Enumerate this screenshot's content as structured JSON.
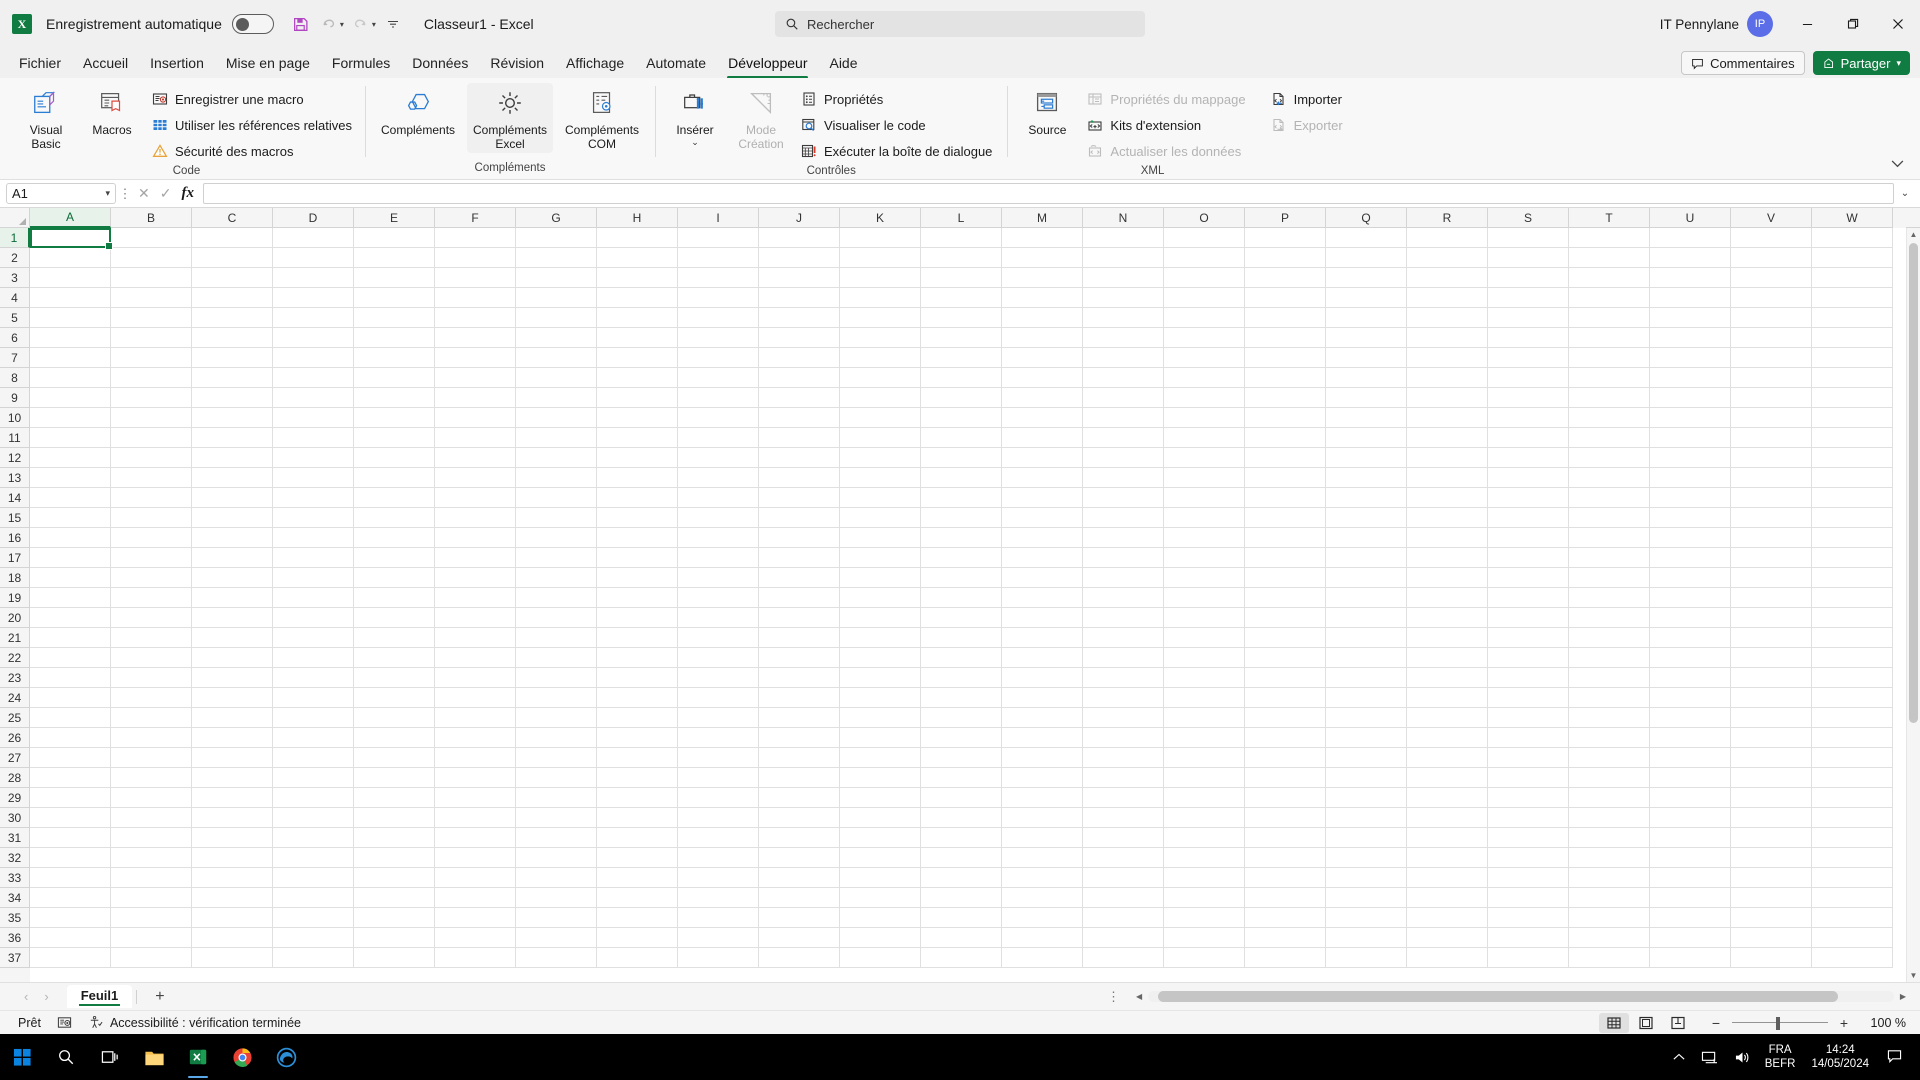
{
  "titlebar": {
    "app_logo": "excel-logo",
    "logo_letter": "X",
    "autosave_label": "Enregistrement automatique",
    "autosave_state": "off",
    "qat": [
      {
        "name": "save",
        "icon": "save-icon"
      },
      {
        "name": "undo",
        "icon": "undo-icon"
      },
      {
        "name": "redo",
        "icon": "redo-icon"
      },
      {
        "name": "customize-quick-access-toolbar",
        "icon": "chevron-down-icon"
      }
    ],
    "document_title": "Classeur1  -  Excel",
    "search_placeholder": "Rechercher",
    "user_name": "IT Pennylane",
    "user_initials": "IP",
    "window": {
      "minimize": "—",
      "restore": "❐",
      "close": "✕"
    }
  },
  "tabs": [
    {
      "label": "Fichier",
      "active": false
    },
    {
      "label": "Accueil",
      "active": false
    },
    {
      "label": "Insertion",
      "active": false
    },
    {
      "label": "Mise en page",
      "active": false
    },
    {
      "label": "Formules",
      "active": false
    },
    {
      "label": "Données",
      "active": false
    },
    {
      "label": "Révision",
      "active": false
    },
    {
      "label": "Affichage",
      "active": false
    },
    {
      "label": "Automate",
      "active": false
    },
    {
      "label": "Développeur",
      "active": true
    },
    {
      "label": "Aide",
      "active": false
    }
  ],
  "tabstrip_right": {
    "comments_label": "Commentaires",
    "share_label": "Partager"
  },
  "ribbon": {
    "groups": [
      {
        "title": "Code",
        "big_buttons": [
          {
            "label": "Visual Basic",
            "icon": "visual-basic-icon",
            "disabled": false,
            "highlighted": false
          },
          {
            "label": "Macros",
            "icon": "macros-icon",
            "disabled": false,
            "highlighted": false
          }
        ],
        "small_items": [
          {
            "label": "Enregistrer une macro",
            "icon": "record-macro-icon",
            "disabled": false
          },
          {
            "label": "Utiliser les références relatives",
            "icon": "relative-references-icon",
            "disabled": false
          },
          {
            "label": "Sécurité des macros",
            "icon": "macro-security-icon",
            "disabled": false
          }
        ]
      },
      {
        "title": "Compléments",
        "big_buttons": [
          {
            "label": "Compléments",
            "icon": "addins-icon",
            "disabled": false,
            "highlighted": false
          },
          {
            "label": "Compléments Excel",
            "icon": "excel-addins-icon",
            "disabled": false,
            "highlighted": true
          },
          {
            "label": "Compléments COM",
            "icon": "com-addins-icon",
            "disabled": false,
            "highlighted": false
          }
        ],
        "small_items": []
      },
      {
        "title": "Contrôles",
        "big_buttons": [
          {
            "label": "Insérer",
            "icon": "insert-control-icon",
            "disabled": false,
            "highlighted": false,
            "has_caret": true
          },
          {
            "label": "Mode Création",
            "icon": "design-mode-icon",
            "disabled": true,
            "highlighted": false
          }
        ],
        "small_items": [
          {
            "label": "Propriétés",
            "icon": "properties-icon",
            "disabled": false
          },
          {
            "label": "Visualiser le code",
            "icon": "view-code-icon",
            "disabled": false
          },
          {
            "label": "Exécuter la boîte de dialogue",
            "icon": "run-dialog-icon",
            "disabled": false
          }
        ]
      },
      {
        "title": "XML",
        "big_buttons": [
          {
            "label": "Source",
            "icon": "xml-source-icon",
            "disabled": false,
            "highlighted": false
          }
        ],
        "small_items": [
          {
            "label": "Propriétés du mappage",
            "icon": "map-properties-icon",
            "disabled": true
          },
          {
            "label": "Kits d'extension",
            "icon": "expansion-packs-icon",
            "disabled": false
          },
          {
            "label": "Actualiser les données",
            "icon": "refresh-data-icon",
            "disabled": true
          }
        ],
        "small_items_2": [
          {
            "label": "Importer",
            "icon": "import-icon",
            "disabled": false
          },
          {
            "label": "Exporter",
            "icon": "export-icon",
            "disabled": true
          }
        ]
      }
    ],
    "collapse_icon": "chevron-up-icon"
  },
  "formulabar": {
    "namebox_value": "A1",
    "cancel_icon": "cancel-icon",
    "confirm_icon": "confirm-icon",
    "fx_label": "fx",
    "formula_value": "",
    "expand_icon": "chevron-down-icon"
  },
  "grid": {
    "columns": [
      "A",
      "B",
      "C",
      "D",
      "E",
      "F",
      "G",
      "H",
      "I",
      "J",
      "K",
      "L",
      "M",
      "N",
      "O",
      "P",
      "Q",
      "R",
      "S",
      "T",
      "U",
      "V",
      "W"
    ],
    "rows": [
      1,
      2,
      3,
      4,
      5,
      6,
      7,
      8,
      9,
      10,
      11,
      12,
      13,
      14,
      15,
      16,
      17,
      18,
      19,
      20,
      21,
      22,
      23,
      24,
      25,
      26,
      27,
      28,
      29,
      30,
      31,
      32,
      33,
      34,
      35,
      36,
      37
    ],
    "selected_cell": "A1",
    "selected_column": "A",
    "selected_row": 1,
    "cell_values": []
  },
  "sheetbar": {
    "prev_icon": "chevron-left-icon",
    "next_icon": "chevron-right-icon",
    "sheets": [
      {
        "name": "Feuil1",
        "active": true
      }
    ],
    "add_sheet_label": "+",
    "more_icon": "ellipsis-icon"
  },
  "statusbar": {
    "mode": "Prêt",
    "macro_record_icon": "record-macro-status-icon",
    "accessibility": "Accessibilité : vérification terminée",
    "views": [
      {
        "name": "normal-view",
        "icon": "grid-view-icon",
        "active": true
      },
      {
        "name": "page-layout-view",
        "icon": "page-layout-icon",
        "active": false
      },
      {
        "name": "page-break-view",
        "icon": "page-break-icon",
        "active": false
      }
    ],
    "zoom_out": "−",
    "zoom_in": "+",
    "zoom_value": "100 %"
  },
  "taskbar": {
    "items": [
      {
        "name": "start-button",
        "icon": "windows-icon"
      },
      {
        "name": "search-button",
        "icon": "search-icon"
      },
      {
        "name": "task-view-button",
        "icon": "task-view-icon"
      },
      {
        "name": "file-explorer",
        "icon": "folder-icon"
      },
      {
        "name": "excel-app",
        "icon": "excel-icon",
        "open": true
      },
      {
        "name": "chrome-app",
        "icon": "chrome-icon"
      },
      {
        "name": "edge-app",
        "icon": "edge-icon"
      }
    ],
    "tray": {
      "overflow_icon": "chevron-up-icon",
      "network_icon": "network-icon",
      "volume_icon": "volume-icon",
      "lang_line1": "FRA",
      "lang_line2": "BEFR",
      "time": "14:24",
      "date": "14/05/2024",
      "notification_icon": "notification-icon"
    }
  },
  "colors": {
    "excel_green": "#107c41",
    "accent_blue": "#2b7cd3",
    "avatar_blue": "#5b6ee8"
  }
}
